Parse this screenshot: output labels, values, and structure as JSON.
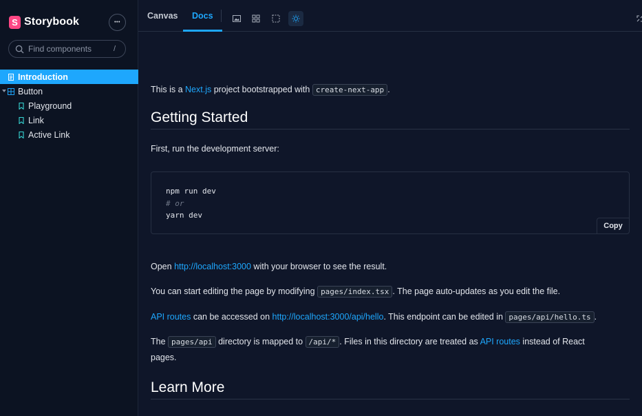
{
  "sidebar": {
    "brand": "Storybook",
    "logo_letter": "S",
    "menu_glyph": "•••",
    "search": {
      "placeholder": "Find components",
      "shortcut": "/"
    },
    "items": [
      {
        "label": "Introduction",
        "icon": "document-icon",
        "active": true
      },
      {
        "label": "Button",
        "icon": "component-icon",
        "expanded": true
      },
      {
        "label": "Playground",
        "icon": "bookmark-icon"
      },
      {
        "label": "Link",
        "icon": "bookmark-icon"
      },
      {
        "label": "Active Link",
        "icon": "bookmark-icon"
      }
    ]
  },
  "toolbar": {
    "tabs": [
      {
        "label": "Canvas"
      },
      {
        "label": "Docs",
        "active": true
      }
    ],
    "tools": [
      "image-icon",
      "grid-icon",
      "outline-icon",
      "theme-icon"
    ]
  },
  "doc": {
    "intro": {
      "t1": "This is a ",
      "link": "Next.js",
      "t2": " project bootstrapped with ",
      "code": "create-next-app",
      "t3": "."
    },
    "h_getting_started": "Getting Started",
    "first_run": "First, run the development server:",
    "codeblock": {
      "line1": "npm run dev",
      "line2": "# or",
      "line3": "yarn dev",
      "copy": "Copy"
    },
    "open": {
      "t1": "Open ",
      "link": "http://localhost:3000",
      "t2": " with your browser to see the result."
    },
    "edit": {
      "t1": "You can start editing the page by modifying ",
      "code": "pages/index.tsx",
      "t2": ". The page auto-updates as you edit the file."
    },
    "api": {
      "link1": "API routes",
      "t1": " can be accessed on ",
      "link2": "http://localhost:3000/api/hello",
      "t2": ". This endpoint can be edited in ",
      "code": "pages/api/hello.ts",
      "t3": "."
    },
    "dir": {
      "t1": "The ",
      "code1": "pages/api",
      "t2": " directory is mapped to ",
      "code2": "/api/*",
      "t3": ". Files in this directory are treated as ",
      "link": "API routes",
      "t4": " instead of React",
      "t5": "pages."
    },
    "h_learn_more": "Learn More"
  },
  "colors": {
    "accent": "#1ea7fd",
    "brand": "#ff4785",
    "background": "#0f1629",
    "sidebar": "#0c1322"
  }
}
